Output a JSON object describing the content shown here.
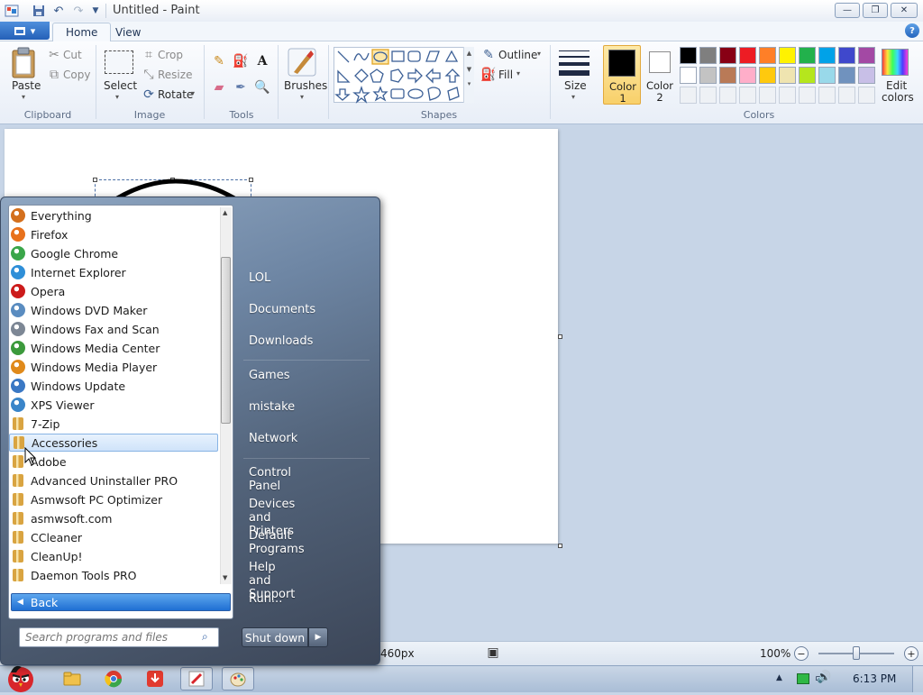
{
  "window": {
    "title": "Untitled - Paint",
    "minimize": "—",
    "restore": "❐",
    "close": "✕",
    "help": "?"
  },
  "tabs": [
    {
      "label": "Home"
    },
    {
      "label": "View"
    }
  ],
  "ribbon": {
    "clipboard": {
      "paste": "Paste",
      "cut": "Cut",
      "copy": "Copy",
      "group": "Clipboard"
    },
    "image": {
      "select": "Select",
      "crop": "Crop",
      "resize": "Resize",
      "rotate": "Rotate",
      "group": "Image"
    },
    "tools": {
      "group": "Tools"
    },
    "brushes": {
      "label": "Brushes"
    },
    "shapes": {
      "outline": "Outline",
      "fill": "Fill",
      "group": "Shapes"
    },
    "size": {
      "label": "Size"
    },
    "color1": {
      "label": "Color",
      "num": "1",
      "value": "#000000"
    },
    "color2": {
      "label": "Color",
      "num": "2",
      "value": "#ffffff"
    },
    "colors": {
      "group": "Colors",
      "edit": "Edit",
      "edit2": "colors",
      "palette": [
        "#000000",
        "#7f7f7f",
        "#880015",
        "#ed1c24",
        "#ff7f27",
        "#fff200",
        "#22b14c",
        "#00a2e8",
        "#3f48cc",
        "#a349a4",
        "#ffffff",
        "#c3c3c3",
        "#b97a57",
        "#ffaec9",
        "#ffc90e",
        "#efe4b0",
        "#b5e61d",
        "#99d9ea",
        "#7092be",
        "#c8bfe7"
      ]
    }
  },
  "status": {
    "size": "460px",
    "zoom": "100%"
  },
  "startmenu": {
    "programs": [
      {
        "label": "Everything",
        "icon": "magnifier-icon",
        "color": "#d4701d"
      },
      {
        "label": "Firefox",
        "icon": "firefox-icon",
        "color": "#e8711c"
      },
      {
        "label": "Google Chrome",
        "icon": "chrome-icon",
        "color": "#3aa64a"
      },
      {
        "label": "Internet Explorer",
        "icon": "ie-icon",
        "color": "#2f8fd8"
      },
      {
        "label": "Opera",
        "icon": "opera-icon",
        "color": "#cc1b1b"
      },
      {
        "label": "Windows DVD Maker",
        "icon": "dvd-maker-icon",
        "color": "#5a8cc0"
      },
      {
        "label": "Windows Fax and Scan",
        "icon": "fax-icon",
        "color": "#7d8795"
      },
      {
        "label": "Windows Media Center",
        "icon": "media-center-icon",
        "color": "#3c9a3c"
      },
      {
        "label": "Windows Media Player",
        "icon": "media-player-icon",
        "color": "#e08a1b"
      },
      {
        "label": "Windows Update",
        "icon": "update-icon",
        "color": "#3a78c4"
      },
      {
        "label": "XPS Viewer",
        "icon": "xps-icon",
        "color": "#3a85c9"
      },
      {
        "label": "7-Zip",
        "icon": "folder-icon",
        "color": "#d9a441"
      },
      {
        "label": "Accessories",
        "icon": "folder-icon",
        "color": "#d9a441"
      },
      {
        "label": "Adobe",
        "icon": "folder-icon",
        "color": "#d9a441"
      },
      {
        "label": "Advanced Uninstaller PRO",
        "icon": "folder-icon",
        "color": "#d9a441"
      },
      {
        "label": "Asmwsoft PC Optimizer",
        "icon": "folder-icon",
        "color": "#d9a441"
      },
      {
        "label": "asmwsoft.com",
        "icon": "folder-icon",
        "color": "#d9a441"
      },
      {
        "label": "CCleaner",
        "icon": "folder-icon",
        "color": "#d9a441"
      },
      {
        "label": "CleanUp!",
        "icon": "folder-icon",
        "color": "#d9a441"
      },
      {
        "label": "Daemon Tools PRO",
        "icon": "folder-icon",
        "color": "#d9a441"
      }
    ],
    "selected_index": 12,
    "back": "Back",
    "search_placeholder": "Search programs and files",
    "right": [
      {
        "label": "LOL"
      },
      {
        "label": "Documents"
      },
      {
        "label": "Downloads"
      },
      {
        "label": "Games"
      },
      {
        "label": "mistake"
      },
      {
        "label": "Network"
      },
      {
        "label": "Control Panel"
      },
      {
        "label": "Devices and Printers"
      },
      {
        "label": "Default Programs"
      },
      {
        "label": "Help and Support"
      },
      {
        "label": "Run..."
      }
    ],
    "shutdown": "Shut down"
  },
  "taskbar": {
    "clock": "6:13 PM"
  }
}
